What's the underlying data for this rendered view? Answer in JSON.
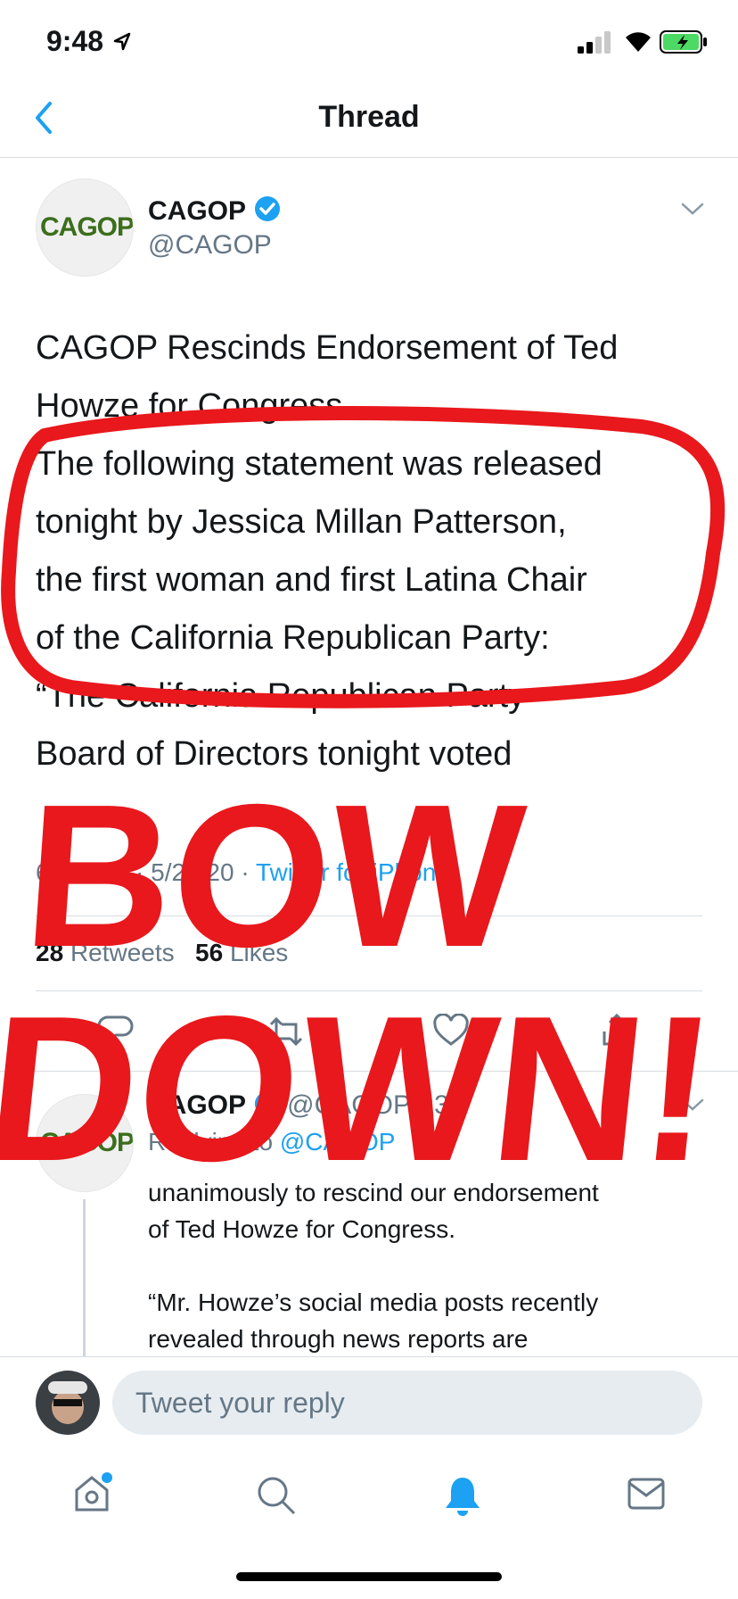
{
  "status_bar": {
    "time": "9:48"
  },
  "nav": {
    "title": "Thread"
  },
  "tweet": {
    "avatar_logo": "CAGOP",
    "name": "CAGOP",
    "handle": "@CAGOP",
    "lines": [
      "CAGOP Rescinds Endorsement of Ted",
      "Howze for Congress",
      "The following statement was released",
      "tonight by Jessica Millan Patterson,",
      "the first woman and first Latina Chair",
      "of the California Republican Party:",
      "“The California Republican Party",
      "Board of Directors tonight voted"
    ],
    "timestamp": "6:25 PM · 5/21/20 · ",
    "source": "Twitter for iPhone",
    "retweets_count": "28",
    "retweets_label": "Retweets",
    "likes_count": "56",
    "likes_label": "Likes"
  },
  "reply_tweet": {
    "avatar_logo": "CAGOP",
    "name": "CAGOP",
    "handle": "@CAGOP · 3h",
    "replying_prefix": "Replying to ",
    "replying_handle": "@CAGOP",
    "lines": [
      "unanimously to rescind our endorsement",
      "of Ted Howze for Congress.",
      "",
      "“Mr. Howze’s social media posts recently",
      "revealed through news reports are"
    ]
  },
  "reply_box": {
    "placeholder": "Tweet your reply"
  },
  "annotation": {
    "line1": "BOW",
    "line2": "DOWN!"
  },
  "colors": {
    "accent": "#1da1f2",
    "annotation": "#e8181c"
  },
  "icons": [
    "back-icon",
    "verified-icon",
    "chevron-down-icon",
    "reply-icon",
    "retweet-icon",
    "like-icon",
    "share-icon",
    "home-icon",
    "search-icon",
    "notifications-icon",
    "messages-icon"
  ]
}
